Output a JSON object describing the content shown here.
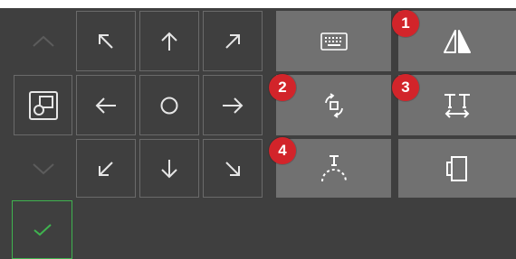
{
  "directional_pad": {
    "up_left_icon": "arrow-up-left-icon",
    "up_icon": "arrow-up-icon",
    "up_right_icon": "arrow-up-right-icon",
    "left_icon": "arrow-left-icon",
    "center_icon": "circle-center-icon",
    "right_icon": "arrow-right-icon",
    "down_left_icon": "arrow-down-left-icon",
    "down_icon": "arrow-down-icon",
    "down_right_icon": "arrow-down-right-icon"
  },
  "side_controls": {
    "scroll_up_icon": "chevron-up-icon",
    "select_icon": "overlapping-squares-icon",
    "scroll_down_icon": "chevron-down-icon",
    "confirm_icon": "checkmark-icon"
  },
  "tools": [
    {
      "icon": "keyboard-icon"
    },
    {
      "icon": "mirror-triangle-icon",
      "badge": "1"
    },
    {
      "icon": "rotate-icon",
      "badge": "2"
    },
    {
      "icon": "text-spacing-icon",
      "badge": "3"
    },
    {
      "icon": "text-arc-icon",
      "badge": "4"
    },
    {
      "icon": "frame-icon"
    }
  ],
  "colors": {
    "panel": "#3f3f3f",
    "tool_button": "#717171",
    "badge": "#d2242a",
    "confirm_border": "#3fb34f"
  }
}
